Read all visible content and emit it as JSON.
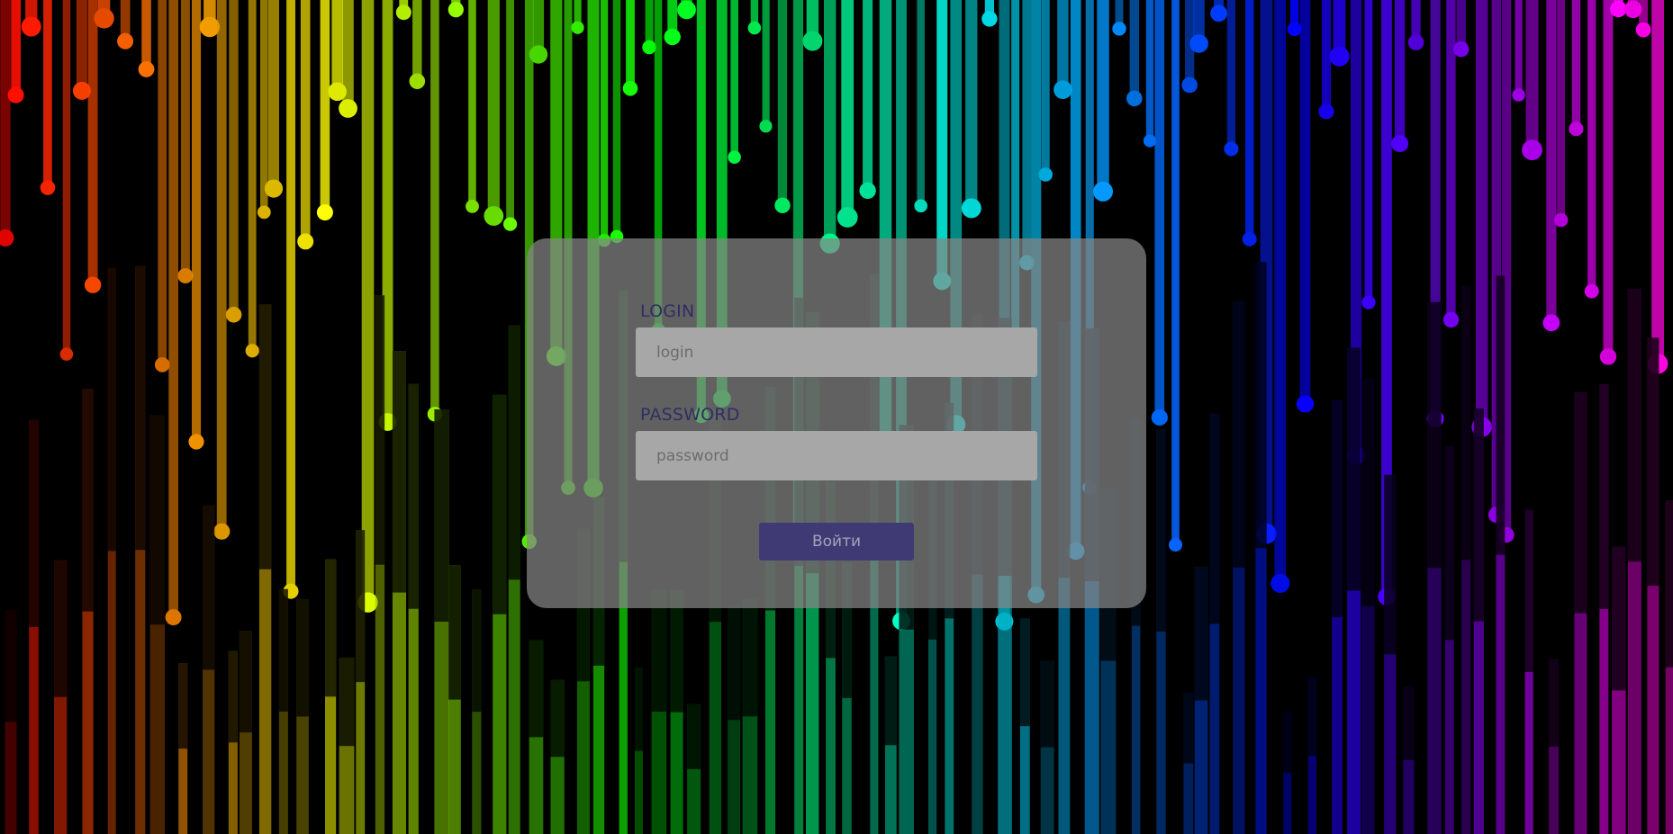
{
  "login_form": {
    "login_label": "LOGIN",
    "login_placeholder": "login",
    "login_value": "",
    "password_label": "PASSWORD",
    "password_placeholder": "password",
    "password_value": "",
    "submit_label": "Войти"
  },
  "colors": {
    "background": "#000000",
    "card": "#878787",
    "input": "#a7a7a7",
    "label_text": "#2f2e63",
    "button": "#3f3a74"
  }
}
